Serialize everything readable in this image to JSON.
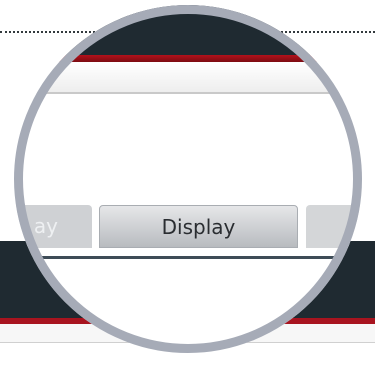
{
  "tabs": {
    "left_partial_label": "ay",
    "active_label": "Display"
  }
}
